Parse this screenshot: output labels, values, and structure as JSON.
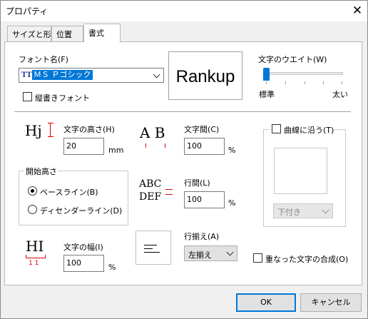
{
  "window": {
    "title": "プロパティ",
    "close_symbol": "✕"
  },
  "tabs": [
    {
      "label": "サイズと形"
    },
    {
      "label": "位置"
    },
    {
      "label": "書式"
    }
  ],
  "font": {
    "label": "フォント名(F)",
    "value": "ＭＳ Ｐゴシック",
    "type_icon": "TT",
    "vertical_label": "縦書きフォント",
    "vertical_checked": false
  },
  "preview": {
    "text": "Rankup"
  },
  "weight": {
    "label": "文字のウエイト(W)",
    "min_label": "標準",
    "max_label": "太い",
    "level": 0
  },
  "height": {
    "icon_text": "Hj",
    "label": "文字の高さ(H)",
    "value": "20",
    "unit": "mm"
  },
  "spacing": {
    "icon_text": "A B",
    "label": "文字間(C)",
    "value": "100",
    "unit": "%"
  },
  "curve": {
    "label": "曲線に沿う(T)",
    "checked": false,
    "position_value": "下付き"
  },
  "start_height": {
    "title": "開始高さ",
    "options": [
      {
        "label": "ベースライン(B)",
        "checked": true
      },
      {
        "label": "ディセンダーライン(D)",
        "checked": false
      }
    ]
  },
  "line_spacing": {
    "icon_line1": "ABC",
    "icon_line2": "DEF",
    "label": "行間(L)",
    "value": "100",
    "unit": "%"
  },
  "char_width": {
    "icon_text": "HI",
    "icon_numbers": "1 1",
    "label": "文字の幅(I)",
    "value": "100",
    "unit": "%"
  },
  "alignment": {
    "label": "行揃え(A)",
    "value": "左揃え"
  },
  "overlap": {
    "label": "重なった文字の合成(O)",
    "checked": false
  },
  "buttons": {
    "ok": "OK",
    "cancel": "キャンセル"
  }
}
